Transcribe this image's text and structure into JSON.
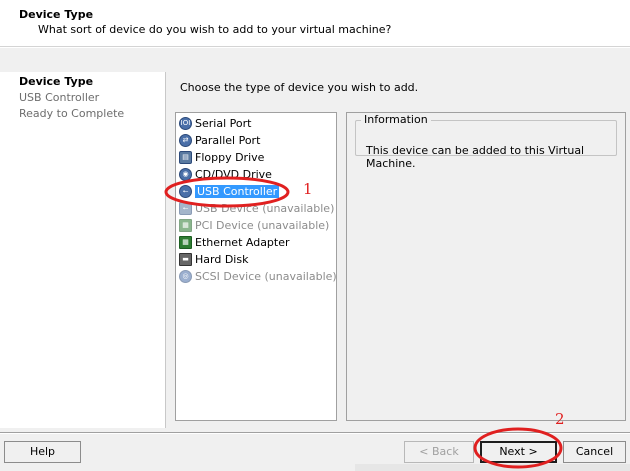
{
  "header": {
    "title": "Device Type",
    "subtitle": "What sort of device do you wish to add to your virtual machine?"
  },
  "steps": [
    {
      "label": "Device Type",
      "active": true
    },
    {
      "label": "USB Controller",
      "active": false
    },
    {
      "label": "Ready to Complete",
      "active": false
    }
  ],
  "main": {
    "instruction": "Choose the type of device you wish to add.",
    "devices": [
      {
        "label": "Serial Port",
        "icon": "serial-port-icon",
        "available": true
      },
      {
        "label": "Parallel Port",
        "icon": "parallel-port-icon",
        "available": true
      },
      {
        "label": "Floppy Drive",
        "icon": "floppy-drive-icon",
        "available": true
      },
      {
        "label": "CD/DVD Drive",
        "icon": "cd-dvd-drive-icon",
        "available": true
      },
      {
        "label": "USB Controller",
        "icon": "usb-controller-icon",
        "available": true,
        "selected": true
      },
      {
        "label": "USB Device (unavailable)",
        "icon": "usb-device-icon",
        "available": false
      },
      {
        "label": "PCI Device (unavailable)",
        "icon": "pci-device-icon",
        "available": false
      },
      {
        "label": "Ethernet Adapter",
        "icon": "ethernet-adapter-icon",
        "available": true
      },
      {
        "label": "Hard Disk",
        "icon": "hard-disk-icon",
        "available": true
      },
      {
        "label": "SCSI Device (unavailable)",
        "icon": "scsi-device-icon",
        "available": false
      }
    ]
  },
  "info": {
    "legend": "Information",
    "text": "This device can be added to this Virtual Machine."
  },
  "footer": {
    "help": "Help",
    "back": "< Back",
    "next": "Next >",
    "cancel": "Cancel"
  },
  "annotations": {
    "one": "1",
    "two": "2",
    "color": "#e02020"
  }
}
